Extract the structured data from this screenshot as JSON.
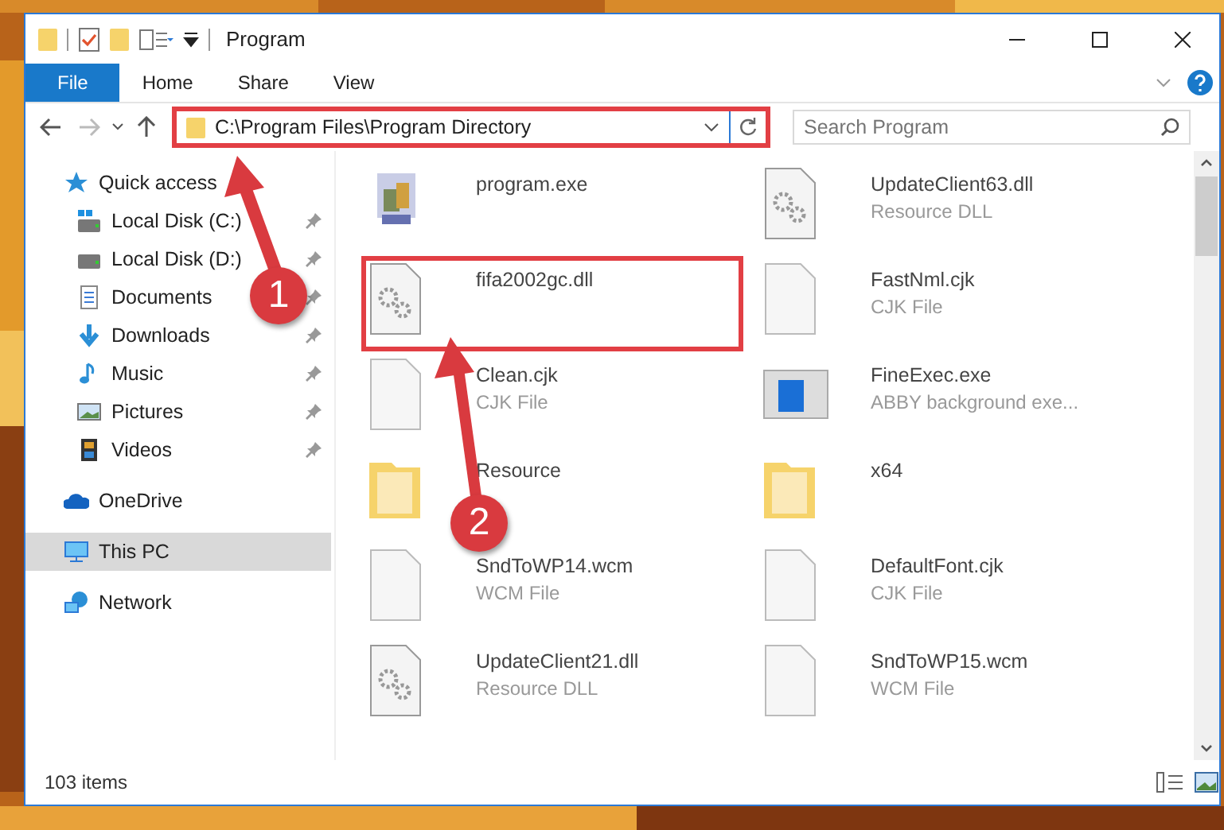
{
  "window": {
    "title": "Program"
  },
  "ribbon": {
    "tabs": [
      {
        "label": "File",
        "selected": true
      },
      {
        "label": "Home",
        "selected": false
      },
      {
        "label": "Share",
        "selected": false
      },
      {
        "label": "View",
        "selected": false
      }
    ]
  },
  "address_bar": {
    "path": "C:\\Program Files\\Program Directory",
    "highlighted": true
  },
  "search": {
    "placeholder": "Search Program"
  },
  "sidebar": {
    "items": [
      {
        "label": "Quick access",
        "selected": false,
        "children": [
          {
            "label": "Local Disk (C:)",
            "pinned": true
          },
          {
            "label": "Local Disk (D:)",
            "pinned": true
          },
          {
            "label": "Documents",
            "pinned": true
          },
          {
            "label": "Downloads",
            "pinned": true
          },
          {
            "label": "Music",
            "pinned": true
          },
          {
            "label": "Pictures",
            "pinned": true
          },
          {
            "label": "Videos",
            "pinned": true
          }
        ]
      },
      {
        "label": "OneDrive",
        "selected": false
      },
      {
        "label": "This PC",
        "selected": true
      },
      {
        "label": "Network",
        "selected": false
      }
    ]
  },
  "files": [
    {
      "name": "program.exe",
      "kind": "exe",
      "highlighted": false
    },
    {
      "name": "UpdateClient63.dll",
      "type": "Resource DLL",
      "kind": "dll",
      "highlighted": false
    },
    {
      "name": "fifa2002gc.dll",
      "kind": "dll",
      "highlighted": true
    },
    {
      "name": "FastNml.cjk",
      "type": "CJK File",
      "kind": "blank",
      "highlighted": false
    },
    {
      "name": "Clean.cjk",
      "type": "CJK File",
      "kind": "blank",
      "highlighted": false
    },
    {
      "name": "FineExec.exe",
      "type": "ABBY background exe...",
      "kind": "app",
      "highlighted": false
    },
    {
      "name": "Resource",
      "kind": "folder",
      "highlighted": false
    },
    {
      "name": "x64",
      "kind": "folder",
      "highlighted": false
    },
    {
      "name": "SndToWP14.wcm",
      "type": "WCM File",
      "kind": "blank",
      "highlighted": false
    },
    {
      "name": "DefaultFont.cjk",
      "type": "CJK File",
      "kind": "blank",
      "highlighted": false
    },
    {
      "name": "UpdateClient21.dll",
      "type": "Resource DLL",
      "kind": "dll",
      "highlighted": false
    },
    {
      "name": "SndToWP15.wcm",
      "type": "WCM File",
      "kind": "blank",
      "highlighted": false
    }
  ],
  "status_bar": {
    "item_count": "103 items"
  },
  "annotations": [
    {
      "number": "1"
    },
    {
      "number": "2"
    }
  ]
}
